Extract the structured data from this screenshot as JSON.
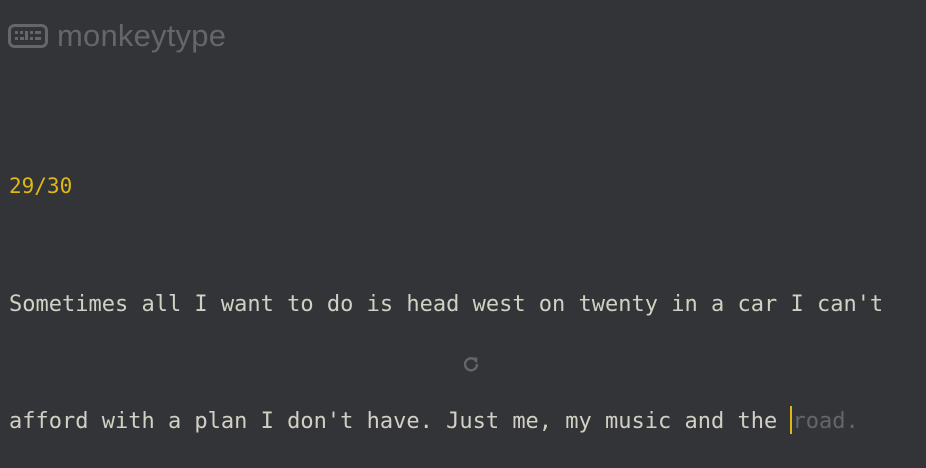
{
  "header": {
    "logo_text": "monkeytype",
    "logo_icon": "keyboard-icon"
  },
  "test": {
    "word_counter": "29/30",
    "typed_text": {
      "line1": "Sometimes all I want to do is head west on twenty in a car I can't",
      "line2": "afford with a plan I don't have. Just me, my music and the "
    },
    "remaining_text": "road."
  },
  "controls": {
    "restart_icon": "restart-icon"
  },
  "colors": {
    "background": "#323437",
    "main": "#e2b714",
    "text": "#d1d0c5",
    "sub": "#646669"
  }
}
